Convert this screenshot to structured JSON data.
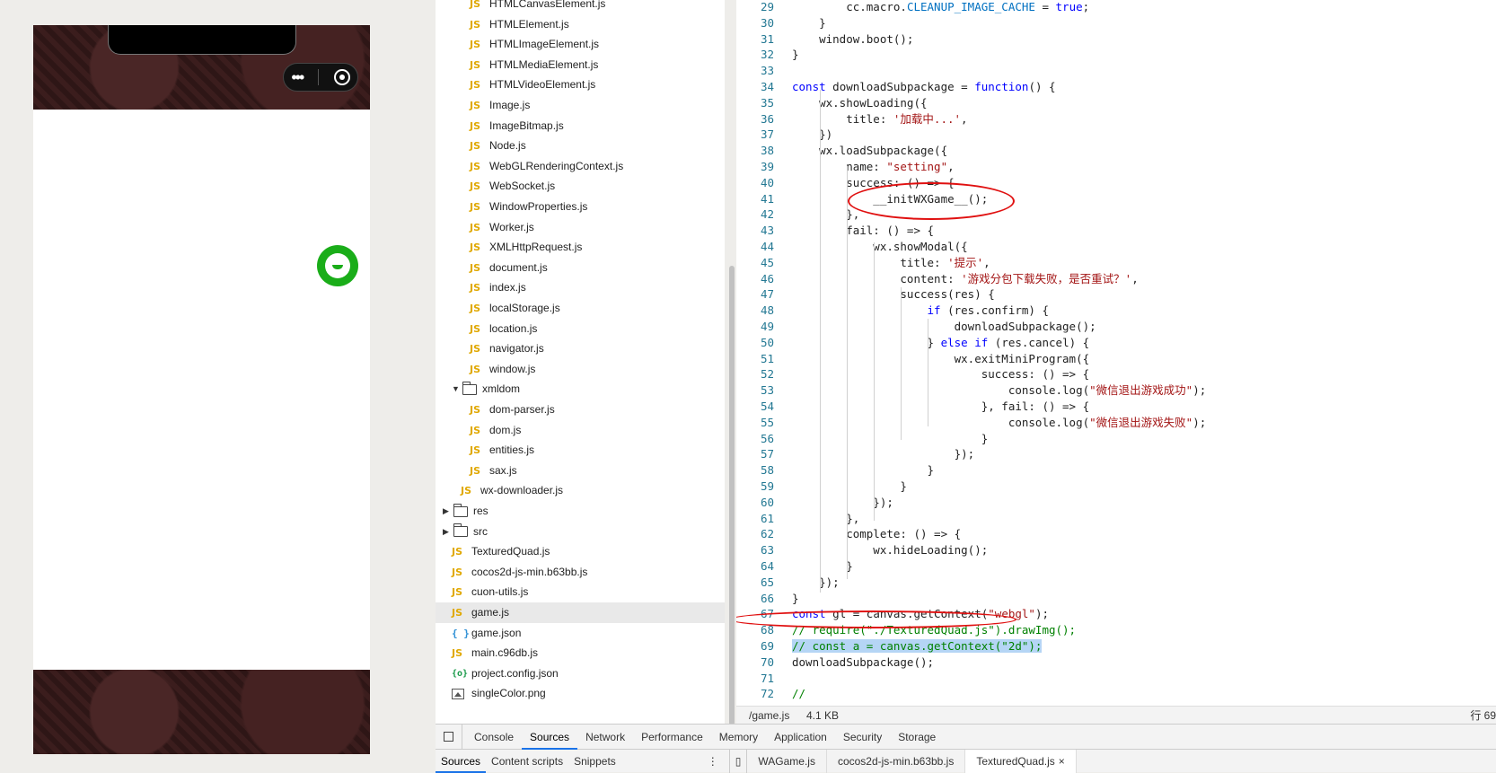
{
  "tree": {
    "items": [
      {
        "icon": "js",
        "label": "HTMLCanvasElement.js"
      },
      {
        "icon": "js",
        "label": "HTMLElement.js"
      },
      {
        "icon": "js",
        "label": "HTMLImageElement.js"
      },
      {
        "icon": "js",
        "label": "HTMLMediaElement.js"
      },
      {
        "icon": "js",
        "label": "HTMLVideoElement.js"
      },
      {
        "icon": "js",
        "label": "Image.js"
      },
      {
        "icon": "js",
        "label": "ImageBitmap.js"
      },
      {
        "icon": "js",
        "label": "Node.js"
      },
      {
        "icon": "js",
        "label": "WebGLRenderingContext.js"
      },
      {
        "icon": "js",
        "label": "WebSocket.js"
      },
      {
        "icon": "js",
        "label": "WindowProperties.js"
      },
      {
        "icon": "js",
        "label": "Worker.js"
      },
      {
        "icon": "js",
        "label": "XMLHttpRequest.js"
      },
      {
        "icon": "js",
        "label": "document.js"
      },
      {
        "icon": "js",
        "label": "index.js"
      },
      {
        "icon": "js",
        "label": "localStorage.js"
      },
      {
        "icon": "js",
        "label": "location.js"
      },
      {
        "icon": "js",
        "label": "navigator.js"
      },
      {
        "icon": "js",
        "label": "window.js"
      },
      {
        "icon": "folder-open",
        "label": "xmldom"
      },
      {
        "icon": "js",
        "label": "dom-parser.js"
      },
      {
        "icon": "js",
        "label": "dom.js"
      },
      {
        "icon": "js",
        "label": "entities.js"
      },
      {
        "icon": "js",
        "label": "sax.js"
      },
      {
        "icon": "js",
        "label": "wx-downloader.js"
      },
      {
        "icon": "folder",
        "label": "res"
      },
      {
        "icon": "folder",
        "label": "src"
      },
      {
        "icon": "js",
        "label": "TexturedQuad.js"
      },
      {
        "icon": "js",
        "label": "cocos2d-js-min.b63bb.js"
      },
      {
        "icon": "js",
        "label": "cuon-utils.js"
      },
      {
        "icon": "js",
        "label": "game.js"
      },
      {
        "icon": "braces",
        "label": "game.json"
      },
      {
        "icon": "js",
        "label": "main.c96db.js"
      },
      {
        "icon": "json",
        "label": "project.config.json"
      },
      {
        "icon": "image",
        "label": "singleColor.png"
      }
    ]
  },
  "code": {
    "lines": [
      {
        "n": "29",
        "t": "        cc.macro.CLEANUP_IMAGE_CACHE = true;"
      },
      {
        "n": "30",
        "t": "    }"
      },
      {
        "n": "31",
        "t": "    window.boot();"
      },
      {
        "n": "32",
        "t": "}"
      },
      {
        "n": "33",
        "t": ""
      },
      {
        "n": "34",
        "t": "const downloadSubpackage = function() {"
      },
      {
        "n": "35",
        "t": "    wx.showLoading({"
      },
      {
        "n": "36",
        "t": "        title: '加载中...',"
      },
      {
        "n": "37",
        "t": "    })"
      },
      {
        "n": "38",
        "t": "    wx.loadSubpackage({"
      },
      {
        "n": "39",
        "t": "        name: \"setting\","
      },
      {
        "n": "40",
        "t": "        success: () => {"
      },
      {
        "n": "41",
        "t": "            __initWXGame__();"
      },
      {
        "n": "42",
        "t": "        },"
      },
      {
        "n": "43",
        "t": "        fail: () => {"
      },
      {
        "n": "44",
        "t": "            wx.showModal({"
      },
      {
        "n": "45",
        "t": "                title: '提示',"
      },
      {
        "n": "46",
        "t": "                content: '游戏分包下载失败，是否重试？',"
      },
      {
        "n": "47",
        "t": "                success(res) {"
      },
      {
        "n": "48",
        "t": "                    if (res.confirm) {"
      },
      {
        "n": "49",
        "t": "                        downloadSubpackage();"
      },
      {
        "n": "50",
        "t": "                    } else if (res.cancel) {"
      },
      {
        "n": "51",
        "t": "                        wx.exitMiniProgram({"
      },
      {
        "n": "52",
        "t": "                            success: () => {"
      },
      {
        "n": "53",
        "t": "                                console.log(\"微信退出游戏成功\");"
      },
      {
        "n": "54",
        "t": "                            }, fail: () => {"
      },
      {
        "n": "55",
        "t": "                                console.log(\"微信退出游戏失败\");"
      },
      {
        "n": "56",
        "t": "                            }"
      },
      {
        "n": "57",
        "t": "                        });"
      },
      {
        "n": "58",
        "t": "                    }"
      },
      {
        "n": "59",
        "t": "                }"
      },
      {
        "n": "60",
        "t": "            });"
      },
      {
        "n": "61",
        "t": "        },"
      },
      {
        "n": "62",
        "t": "        complete: () => {"
      },
      {
        "n": "63",
        "t": "            wx.hideLoading();"
      },
      {
        "n": "64",
        "t": "        }"
      },
      {
        "n": "65",
        "t": "    });"
      },
      {
        "n": "66",
        "t": "}"
      },
      {
        "n": "67",
        "t": "const gl = canvas.getContext(\"webgl\");"
      },
      {
        "n": "68",
        "t": "// require(\"./TexturedQuad.js\").drawImg();"
      },
      {
        "n": "69",
        "t": "// const a = canvas.getContext(\"2d\");"
      },
      {
        "n": "70",
        "t": "downloadSubpackage();"
      },
      {
        "n": "71",
        "t": ""
      },
      {
        "n": "72",
        "t": "//"
      }
    ]
  },
  "status": {
    "path": "/game.js",
    "size": "4.1 KB",
    "pos": "行 69"
  },
  "devtools": {
    "tabs": [
      "Console",
      "Sources",
      "Network",
      "Performance",
      "Memory",
      "Application",
      "Security",
      "Storage"
    ],
    "active_tab": "Sources",
    "subtabs": [
      "Sources",
      "Content scripts",
      "Snippets"
    ],
    "more": "⋮",
    "files": [
      "WAGame.js",
      "cocos2d-js-min.b63bb.js",
      "TexturedQuad.js"
    ],
    "close": "×"
  },
  "colors": {
    "accent": "#1a73e8",
    "annotation_circle": "#e01010",
    "selection": "#b5d5f5",
    "wechat_green": "#1aad19"
  }
}
